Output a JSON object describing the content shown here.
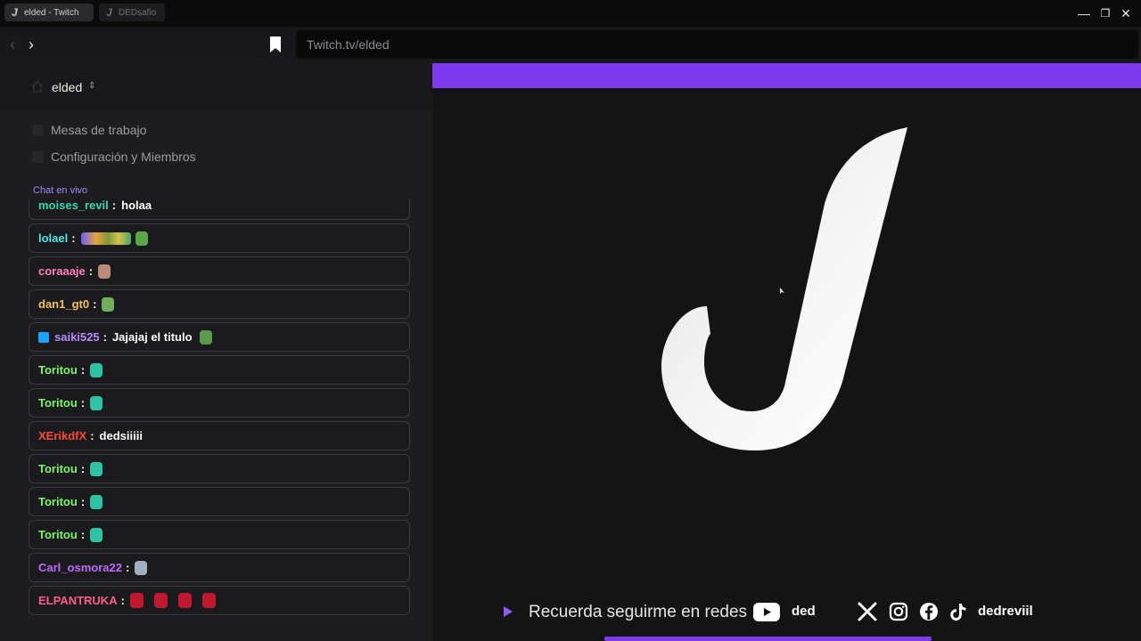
{
  "titlebar": {
    "tabs": [
      {
        "title": "elded - Twitch",
        "icon": "j-logo-icon"
      },
      {
        "title": "DEDsafio",
        "icon": "j-logo-icon"
      }
    ],
    "controls": {
      "minimize": "—",
      "restore": "❐",
      "close": "✕"
    }
  },
  "navbar": {
    "back": "‹",
    "forward": "›",
    "url": "Twitch.tv/elded"
  },
  "sidebar": {
    "workspace": {
      "name": "elded",
      "chevron": "⌃⌄"
    },
    "menu": [
      {
        "label": "Mesas de trabajo",
        "icon": "table-icon"
      },
      {
        "label": "Configuración y Miembros",
        "icon": "settings-icon"
      }
    ],
    "section_label": "Chat en vivo",
    "chat": [
      {
        "user": "moises_revil",
        "color": "#3ad7b0",
        "text": "holaa",
        "emotes": []
      },
      {
        "user": "lolael",
        "color": "#53e4e8",
        "text": "",
        "emotes": [
          "wide",
          "plant"
        ]
      },
      {
        "user": "coraaaje",
        "color": "#ff7fbe",
        "text": "",
        "emotes": [
          "face"
        ]
      },
      {
        "user": "dan1_gt0",
        "color": "#f0c060",
        "text": "",
        "emotes": [
          "frog"
        ]
      },
      {
        "user": "saiki525",
        "color": "#b98cff",
        "text": "Jajajaj el titulo",
        "emotes": [
          "small-frog"
        ],
        "badge": true
      },
      {
        "user": "Toritou",
        "color": "#7cf76c",
        "text": "",
        "emotes": [
          "dino"
        ]
      },
      {
        "user": "Toritou",
        "color": "#7cf76c",
        "text": "",
        "emotes": [
          "dino"
        ]
      },
      {
        "user": "XErikdfX",
        "color": "#ff4b36",
        "text": "dedsiiiii",
        "emotes": []
      },
      {
        "user": "Toritou",
        "color": "#7cf76c",
        "text": "",
        "emotes": [
          "dino"
        ]
      },
      {
        "user": "Toritou",
        "color": "#7cf76c",
        "text": "",
        "emotes": [
          "dino"
        ]
      },
      {
        "user": "Toritou",
        "color": "#7cf76c",
        "text": "",
        "emotes": [
          "dino"
        ]
      },
      {
        "user": "Carl_osmora22",
        "color": "#c06aff",
        "text": "",
        "emotes": [
          "knife"
        ]
      },
      {
        "user": "ELPANTRUKA",
        "color": "#ff5c8a",
        "text": "",
        "emotes": [
          "red",
          "red",
          "red",
          "red"
        ]
      }
    ]
  },
  "stream": {
    "accent": "#7c3aed",
    "footer_text": "Recuerda seguirme en redes",
    "youtube_name": "ded",
    "social_handle": "dedreviil",
    "social_icons": [
      "x-icon",
      "instagram-icon",
      "facebook-icon",
      "tiktok-icon"
    ]
  }
}
